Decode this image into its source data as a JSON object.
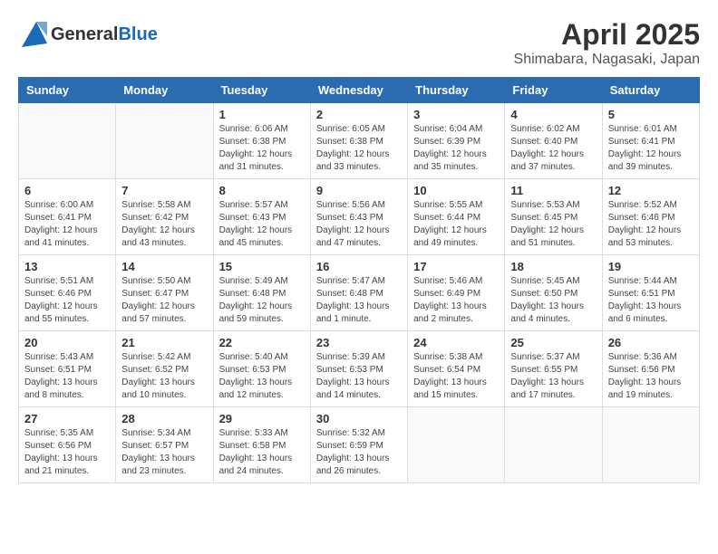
{
  "header": {
    "logo_general": "General",
    "logo_blue": "Blue",
    "title": "April 2025",
    "subtitle": "Shimabara, Nagasaki, Japan"
  },
  "days_of_week": [
    "Sunday",
    "Monday",
    "Tuesday",
    "Wednesday",
    "Thursday",
    "Friday",
    "Saturday"
  ],
  "weeks": [
    [
      {
        "day": "",
        "info": ""
      },
      {
        "day": "",
        "info": ""
      },
      {
        "day": "1",
        "info": "Sunrise: 6:06 AM\nSunset: 6:38 PM\nDaylight: 12 hours\nand 31 minutes."
      },
      {
        "day": "2",
        "info": "Sunrise: 6:05 AM\nSunset: 6:38 PM\nDaylight: 12 hours\nand 33 minutes."
      },
      {
        "day": "3",
        "info": "Sunrise: 6:04 AM\nSunset: 6:39 PM\nDaylight: 12 hours\nand 35 minutes."
      },
      {
        "day": "4",
        "info": "Sunrise: 6:02 AM\nSunset: 6:40 PM\nDaylight: 12 hours\nand 37 minutes."
      },
      {
        "day": "5",
        "info": "Sunrise: 6:01 AM\nSunset: 6:41 PM\nDaylight: 12 hours\nand 39 minutes."
      }
    ],
    [
      {
        "day": "6",
        "info": "Sunrise: 6:00 AM\nSunset: 6:41 PM\nDaylight: 12 hours\nand 41 minutes."
      },
      {
        "day": "7",
        "info": "Sunrise: 5:58 AM\nSunset: 6:42 PM\nDaylight: 12 hours\nand 43 minutes."
      },
      {
        "day": "8",
        "info": "Sunrise: 5:57 AM\nSunset: 6:43 PM\nDaylight: 12 hours\nand 45 minutes."
      },
      {
        "day": "9",
        "info": "Sunrise: 5:56 AM\nSunset: 6:43 PM\nDaylight: 12 hours\nand 47 minutes."
      },
      {
        "day": "10",
        "info": "Sunrise: 5:55 AM\nSunset: 6:44 PM\nDaylight: 12 hours\nand 49 minutes."
      },
      {
        "day": "11",
        "info": "Sunrise: 5:53 AM\nSunset: 6:45 PM\nDaylight: 12 hours\nand 51 minutes."
      },
      {
        "day": "12",
        "info": "Sunrise: 5:52 AM\nSunset: 6:46 PM\nDaylight: 12 hours\nand 53 minutes."
      }
    ],
    [
      {
        "day": "13",
        "info": "Sunrise: 5:51 AM\nSunset: 6:46 PM\nDaylight: 12 hours\nand 55 minutes."
      },
      {
        "day": "14",
        "info": "Sunrise: 5:50 AM\nSunset: 6:47 PM\nDaylight: 12 hours\nand 57 minutes."
      },
      {
        "day": "15",
        "info": "Sunrise: 5:49 AM\nSunset: 6:48 PM\nDaylight: 12 hours\nand 59 minutes."
      },
      {
        "day": "16",
        "info": "Sunrise: 5:47 AM\nSunset: 6:48 PM\nDaylight: 13 hours\nand 1 minute."
      },
      {
        "day": "17",
        "info": "Sunrise: 5:46 AM\nSunset: 6:49 PM\nDaylight: 13 hours\nand 2 minutes."
      },
      {
        "day": "18",
        "info": "Sunrise: 5:45 AM\nSunset: 6:50 PM\nDaylight: 13 hours\nand 4 minutes."
      },
      {
        "day": "19",
        "info": "Sunrise: 5:44 AM\nSunset: 6:51 PM\nDaylight: 13 hours\nand 6 minutes."
      }
    ],
    [
      {
        "day": "20",
        "info": "Sunrise: 5:43 AM\nSunset: 6:51 PM\nDaylight: 13 hours\nand 8 minutes."
      },
      {
        "day": "21",
        "info": "Sunrise: 5:42 AM\nSunset: 6:52 PM\nDaylight: 13 hours\nand 10 minutes."
      },
      {
        "day": "22",
        "info": "Sunrise: 5:40 AM\nSunset: 6:53 PM\nDaylight: 13 hours\nand 12 minutes."
      },
      {
        "day": "23",
        "info": "Sunrise: 5:39 AM\nSunset: 6:53 PM\nDaylight: 13 hours\nand 14 minutes."
      },
      {
        "day": "24",
        "info": "Sunrise: 5:38 AM\nSunset: 6:54 PM\nDaylight: 13 hours\nand 15 minutes."
      },
      {
        "day": "25",
        "info": "Sunrise: 5:37 AM\nSunset: 6:55 PM\nDaylight: 13 hours\nand 17 minutes."
      },
      {
        "day": "26",
        "info": "Sunrise: 5:36 AM\nSunset: 6:56 PM\nDaylight: 13 hours\nand 19 minutes."
      }
    ],
    [
      {
        "day": "27",
        "info": "Sunrise: 5:35 AM\nSunset: 6:56 PM\nDaylight: 13 hours\nand 21 minutes."
      },
      {
        "day": "28",
        "info": "Sunrise: 5:34 AM\nSunset: 6:57 PM\nDaylight: 13 hours\nand 23 minutes."
      },
      {
        "day": "29",
        "info": "Sunrise: 5:33 AM\nSunset: 6:58 PM\nDaylight: 13 hours\nand 24 minutes."
      },
      {
        "day": "30",
        "info": "Sunrise: 5:32 AM\nSunset: 6:59 PM\nDaylight: 13 hours\nand 26 minutes."
      },
      {
        "day": "",
        "info": ""
      },
      {
        "day": "",
        "info": ""
      },
      {
        "day": "",
        "info": ""
      }
    ]
  ]
}
